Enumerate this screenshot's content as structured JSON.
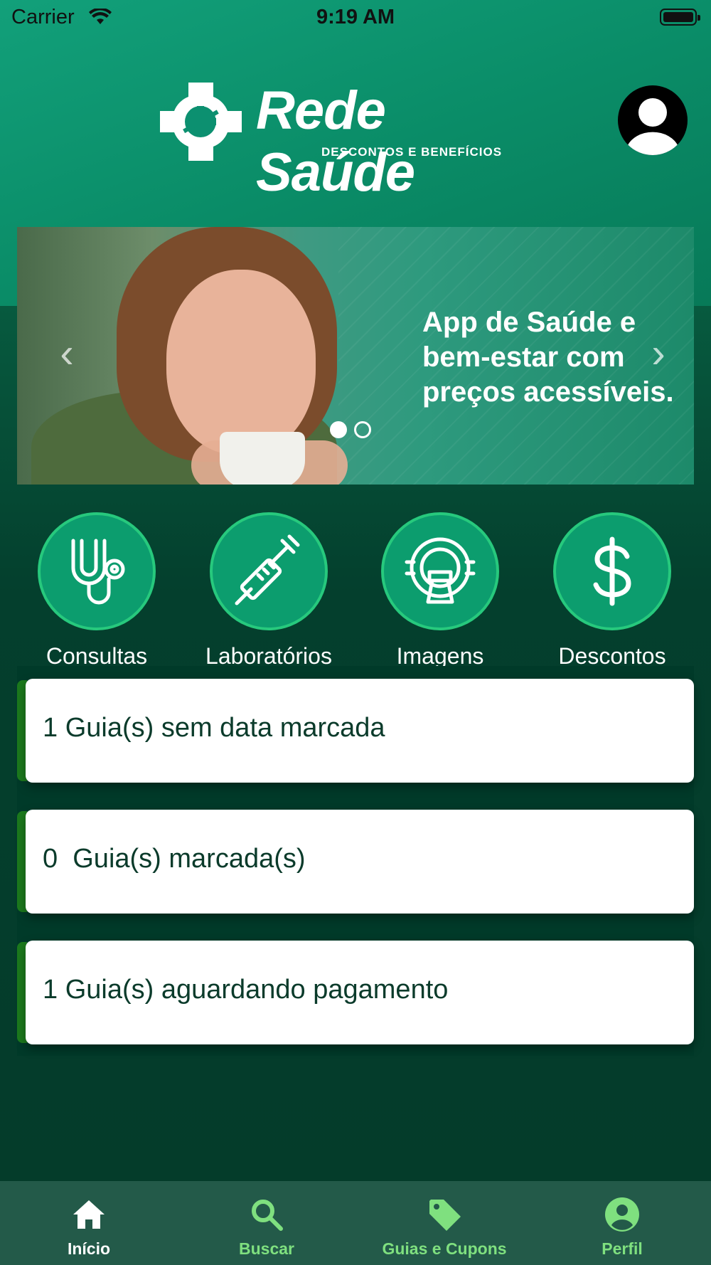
{
  "status_bar": {
    "carrier": "Carrier",
    "time": "9:19 AM"
  },
  "header": {
    "brand_name": "Rede Saúde",
    "brand_tagline": "DESCONTOS E BENEFÍCIOS"
  },
  "banner": {
    "headline": "App de Saúde e bem-estar com preços acessíveis.",
    "slide_count": 2,
    "active_slide": 1
  },
  "categories": [
    {
      "label": "Consultas",
      "icon": "stethoscope-icon"
    },
    {
      "label": "Laboratórios",
      "icon": "syringe-icon"
    },
    {
      "label": "Imagens",
      "icon": "mri-scanner-icon"
    },
    {
      "label": "Descontos",
      "icon": "dollar-icon"
    }
  ],
  "cards": [
    {
      "text": "1 Guia(s) sem data marcada"
    },
    {
      "text": "0  Guia(s) marcada(s)"
    },
    {
      "text": "1 Guia(s) aguardando pagamento"
    }
  ],
  "tabbar": {
    "items": [
      {
        "label": "Início",
        "icon": "home-icon",
        "active": true
      },
      {
        "label": "Buscar",
        "icon": "search-icon",
        "active": false
      },
      {
        "label": "Guias e Cupons",
        "icon": "tag-icon",
        "active": false
      },
      {
        "label": "Perfil",
        "icon": "profile-icon",
        "active": false
      }
    ]
  },
  "colors": {
    "brand_green": "#0c9d6e",
    "accent_light_green": "#7fe07f",
    "tab_bar": "#235a49",
    "dark_background": "#043d2c"
  }
}
